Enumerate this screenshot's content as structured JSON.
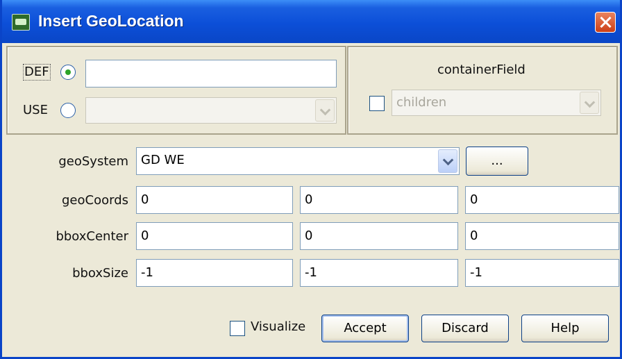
{
  "window": {
    "title": "Insert GeoLocation"
  },
  "def_use": {
    "def_label": "DEF",
    "use_label": "USE",
    "def_value": "",
    "def_selected": true
  },
  "container": {
    "label": "containerField",
    "value": "children"
  },
  "fields": {
    "geoSystem": {
      "label": "geoSystem",
      "value": "GD WE",
      "browse_label": "..."
    },
    "geoCoords": {
      "label": "geoCoords",
      "values": [
        "0",
        "0",
        "0"
      ]
    },
    "bboxCenter": {
      "label": "bboxCenter",
      "values": [
        "0",
        "0",
        "0"
      ]
    },
    "bboxSize": {
      "label": "bboxSize",
      "values": [
        "-1",
        "-1",
        "-1"
      ]
    }
  },
  "actions": {
    "visualize_label": "Visualize",
    "accept_label": "Accept",
    "discard_label": "Discard",
    "help_label": "Help"
  },
  "colors": {
    "title_bar": "#0a46c6",
    "dialog_bg": "#ece9d8",
    "field_border": "#7f9db9",
    "close_button": "#cc3e16"
  }
}
